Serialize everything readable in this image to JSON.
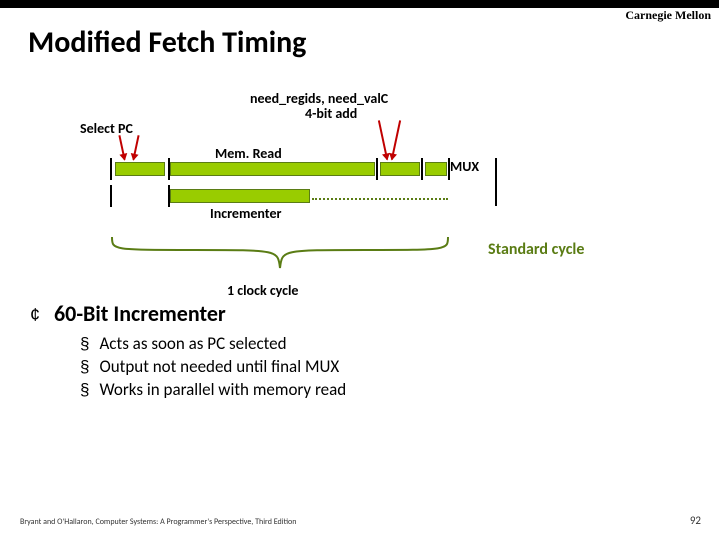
{
  "header": {
    "institution": "Carnegie Mellon"
  },
  "title": "Modified Fetch Timing",
  "diagram": {
    "select_pc": "Select PC",
    "need_line1": "need_regids, need_valC",
    "need_line2": "4-bit add",
    "mem_read": "Mem. Read",
    "mux": "MUX",
    "incrementer": "Incrementer",
    "standard_cycle": "Standard cycle",
    "clock_cycle": "1 clock cycle"
  },
  "content": {
    "heading": "60-Bit Incrementer",
    "points": [
      "Acts as soon as PC selected",
      "Output not needed until final MUX",
      "Works in parallel with memory read"
    ]
  },
  "footer": {
    "citation": "Bryant and O'Hallaron, Computer Systems: A Programmer's Perspective, Third Edition",
    "page": "92"
  },
  "chart_data": {
    "type": "timing-diagram",
    "rows": [
      {
        "name": "main",
        "segments": [
          "Select PC",
          "Mem. Read",
          "need_regids/need_valC 4-bit add",
          "MUX"
        ]
      },
      {
        "name": "parallel",
        "segments": [
          "Incrementer"
        ]
      }
    ],
    "cycle_span": "1 clock cycle",
    "reference": "Standard cycle"
  }
}
